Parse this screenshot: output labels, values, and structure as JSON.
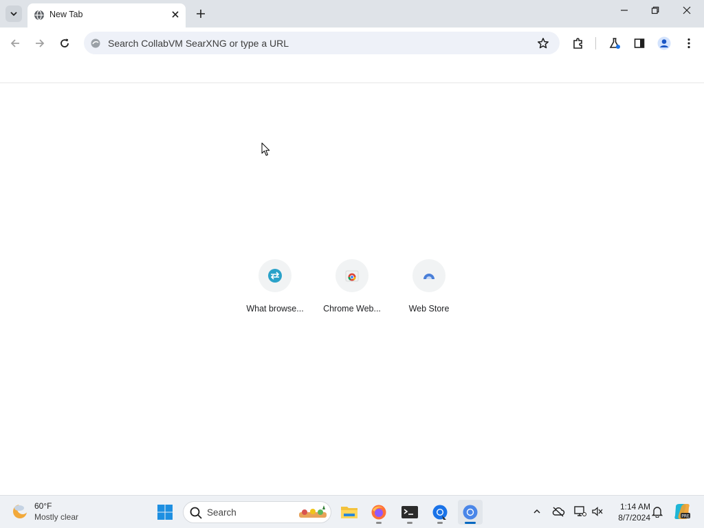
{
  "browser": {
    "tab": {
      "title": "New Tab",
      "favicon": "globe-icon"
    },
    "omnibox": {
      "placeholder": "Search CollabVM SearXNG or type a URL"
    },
    "window_controls": [
      "minimize-icon",
      "restore-icon",
      "close-icon"
    ],
    "toolbar_icons": [
      "back-icon",
      "forward-icon",
      "reload-icon",
      "extensions-icon",
      "labs-icon",
      "side-panel-icon",
      "profile-icon",
      "menu-icon"
    ]
  },
  "shortcuts": [
    {
      "label": "What browse...",
      "icon": "site-favicon"
    },
    {
      "label": "Chrome Web...",
      "icon": "chrome-web-store-icon"
    },
    {
      "label": "Web Store",
      "icon": "web-store-icon"
    }
  ],
  "taskbar": {
    "weather": {
      "temp": "60°F",
      "desc": "Mostly clear"
    },
    "search_label": "Search",
    "apps": [
      "start-icon",
      "file-explorer-icon",
      "firefox-icon",
      "terminal-icon",
      "chrome-canary-icon",
      "chrome-icon"
    ],
    "clock": {
      "time": "1:14 AM",
      "date": "8/7/2024"
    }
  },
  "colors": {
    "accent": "#0067c0",
    "tabstrip": "#dfe3e8",
    "omnibox": "#eef1f8"
  }
}
